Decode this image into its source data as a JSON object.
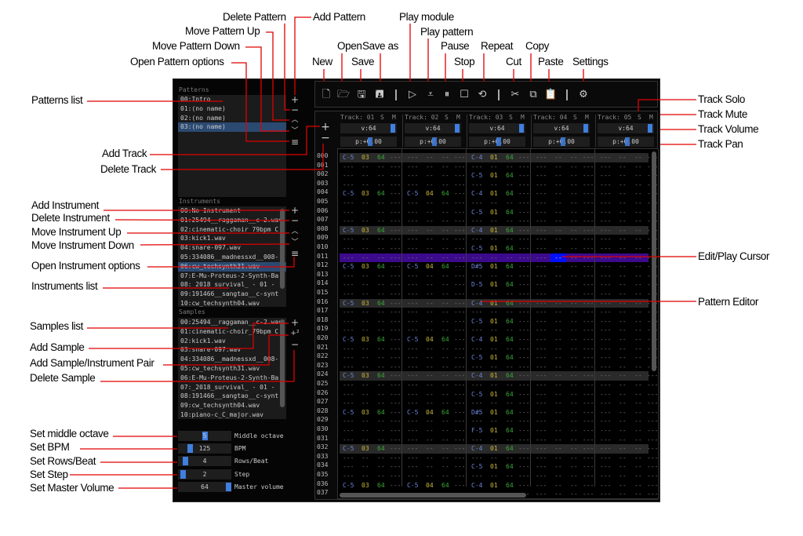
{
  "callouts": {
    "delete_pattern": "Delete Pattern",
    "add_pattern": "Add Pattern",
    "move_pattern_up": "Move Pattern Up",
    "move_pattern_down": "Move Pattern Down",
    "open_pattern_options": "Open Pattern options",
    "new": "New",
    "open": "Open",
    "save": "Save",
    "save_as": "Save as",
    "play_module": "Play module",
    "play_pattern": "Play pattern",
    "pause": "Pause",
    "stop": "Stop",
    "repeat": "Repeat",
    "cut": "Cut",
    "copy": "Copy",
    "paste": "Paste",
    "settings": "Settings",
    "track_solo": "Track Solo",
    "track_mute": "Track Mute",
    "track_volume": "Track Volume",
    "track_pan": "Track Pan",
    "edit_play_cursor": "Edit/Play Cursor",
    "pattern_editor": "Pattern Editor",
    "patterns_list": "Patterns list",
    "add_track": "Add Track",
    "delete_track": "Delete Track",
    "add_instrument": "Add Instrument",
    "delete_instrument": "Delete Instrument",
    "move_instrument_up": "Move Instrument Up",
    "move_instrument_down": "Move Instrument Down",
    "open_instrument_options": "Open Instrument options",
    "instruments_list": "Instruments list",
    "samples_list": "Samples list",
    "add_sample": "Add Sample",
    "add_sample_instrument_pair": "Add Sample/Instrument Pair",
    "delete_sample": "Delete Sample",
    "set_middle_octave": "Set middle octave",
    "set_bpm": "Set BPM",
    "set_rows_beat": "Set Rows/Beat",
    "set_step": "Set Step",
    "set_master_volume": "Set Master Volume"
  },
  "patterns": {
    "heading": "Patterns",
    "items": [
      "00:Intro",
      "01:(no name)",
      "02:(no name)",
      "03:(no name)"
    ],
    "selected": 3
  },
  "instruments": {
    "heading": "Instruments",
    "items": [
      "00:No Instrument",
      "01:25494__raggaman__c-2.wav",
      "02:cinematic-choir_79bpm_C",
      "03:kick1.wav",
      "04:snare-097.wav",
      "05:334086__madnessxd__008-",
      "06:cw_techsynth31.wav",
      "07:E-Mu-Proteus-2-Synth-Ba",
      "08:_2018_survival_ - 01 -",
      "09:191466__sangtao__c-synt",
      "10:cw_techsynth04.wav"
    ],
    "selected": 6
  },
  "samples": {
    "heading": "Samples",
    "items": [
      "00:25494__raggaman__c-2.wav",
      "01:cinematic-choir_79bpm_C",
      "02:kick1.wav",
      "03:snare-097.wav",
      "04:334086__madnessxd__008-",
      "05:cw_techsynth31.wav",
      "06:E-Mu-Proteus-2-Synth-Ba",
      "07:_2018_survival_ - 01 -",
      "08:191466__sangtao__c-synt",
      "09:cw_techsynth04.wav",
      "10:piano-c_C_major.wav"
    ]
  },
  "settings": [
    {
      "label": "Middle octave",
      "value": "5",
      "fraction": 0.5
    },
    {
      "label": "BPM",
      "value": "125",
      "fraction": 0.2
    },
    {
      "label": "Rows/Beat",
      "value": "4",
      "fraction": 0.1
    },
    {
      "label": "Step",
      "value": "2",
      "fraction": 0.05
    },
    {
      "label": "Master volume",
      "value": "64",
      "fraction": 1.0
    }
  ],
  "pattern_buttons": {
    "add": "+",
    "delete": "−",
    "up": "︿",
    "down": "﹀",
    "options": "≡"
  },
  "sample_buttons": {
    "add": "+",
    "add_pair": "+²",
    "delete": "−"
  },
  "track_buttons": {
    "add": "+",
    "delete": "−"
  },
  "toolbar_icons": [
    "new-file-icon",
    "open-folder-icon",
    "save-icon",
    "save-as-icon",
    "play-module-icon",
    "play-pattern-icon",
    "pause-icon",
    "stop-icon",
    "repeat-icon",
    "cut-icon",
    "copy-icon",
    "paste-icon",
    "settings-icon"
  ],
  "tracks": [
    {
      "label": "Track: 01",
      "solo": "S",
      "mute": "M",
      "volume": "v:64",
      "pan": "p:+0.00"
    },
    {
      "label": "Track: 02",
      "solo": "S",
      "mute": "M",
      "volume": "v:64",
      "pan": "p:+0.00"
    },
    {
      "label": "Track: 03",
      "solo": "S",
      "mute": "M",
      "volume": "v:64",
      "pan": "p:+0.00"
    },
    {
      "label": "Track: 04",
      "solo": "S",
      "mute": "M",
      "volume": "v:64",
      "pan": "p:+0.00"
    },
    {
      "label": "Track: 05",
      "solo": "S",
      "mute": "M",
      "volume": "v:64",
      "pan": "p:+0.00"
    }
  ],
  "pattern": {
    "row_count": 38,
    "highlight_every": 8,
    "cursor_row": 11,
    "cursor_track": 3,
    "empty": "--- -- -- ---",
    "notes": [
      {
        "track": 0,
        "rows": [
          0,
          4,
          8,
          12,
          16,
          20,
          24,
          28,
          32,
          36
        ],
        "note": "C-5",
        "inst": "03",
        "vol": "64",
        "fx": "---"
      },
      {
        "track": 1,
        "rows": [
          4,
          12,
          20,
          28,
          36
        ],
        "note": "C-5",
        "inst": "04",
        "vol": "64",
        "fx": "---"
      },
      {
        "track": 2,
        "rows": [
          0,
          4,
          8,
          16,
          20,
          24,
          32,
          36
        ],
        "note": "C-4",
        "inst": "01",
        "vol": "64",
        "fx": "---"
      },
      {
        "track": 2,
        "rows": [
          2,
          6,
          10,
          18,
          22,
          26,
          34
        ],
        "note": "C-5",
        "inst": "01",
        "vol": "64",
        "fx": "---"
      },
      {
        "track": 2,
        "rows": [
          12,
          28
        ],
        "note": "D#5",
        "inst": "01",
        "vol": "64",
        "fx": "---"
      },
      {
        "track": 2,
        "rows": [
          14
        ],
        "note": "D-5",
        "inst": "01",
        "vol": "64",
        "fx": "---"
      },
      {
        "track": 2,
        "rows": [
          30
        ],
        "note": "F-5",
        "inst": "01",
        "vol": "64",
        "fx": "---"
      }
    ]
  },
  "colors": {
    "note": "#6b86d8",
    "instrument": "#c8b83a",
    "volume": "#3aa83a",
    "cursor_row": "#3c0a8c",
    "cursor_cell": "#0010ff",
    "accent": "#3f7fe0",
    "callout_line": "#e00000"
  }
}
